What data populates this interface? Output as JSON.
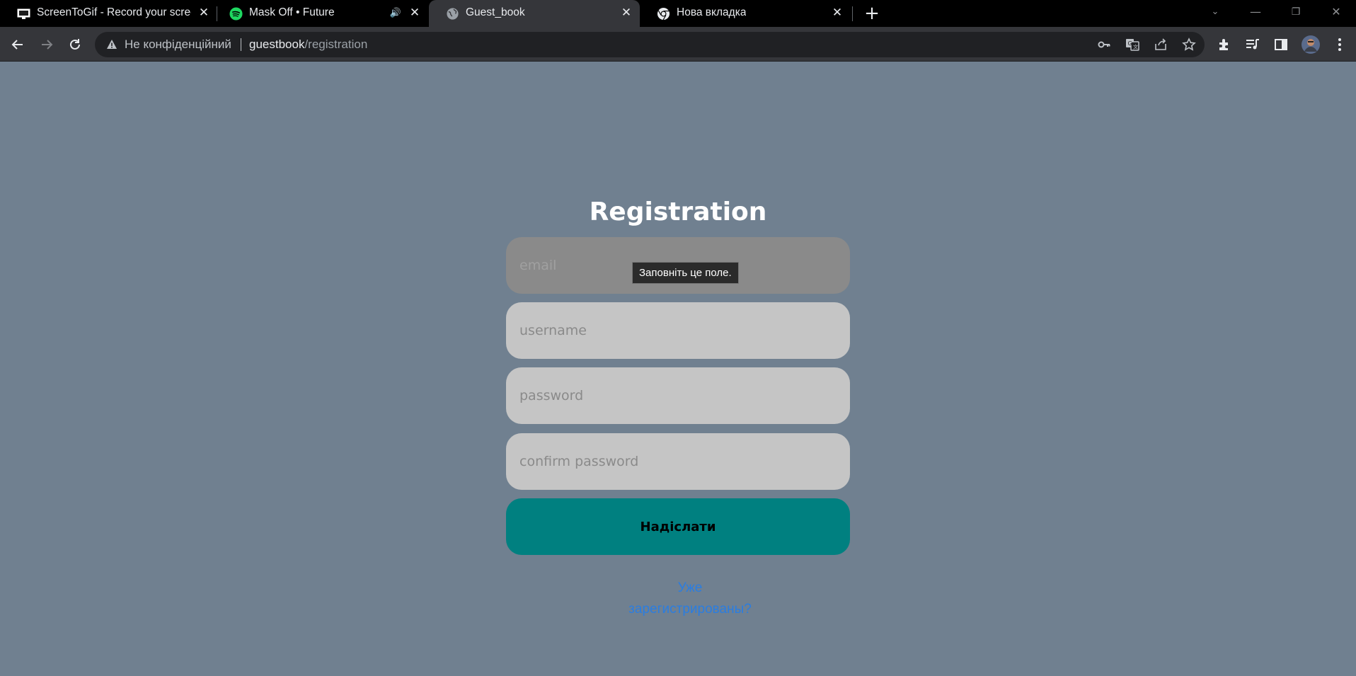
{
  "browser": {
    "tabs": [
      {
        "title": "ScreenToGif - Record your screen",
        "icon": "screentogif-favicon",
        "active": false
      },
      {
        "title": "Mask Off • Future",
        "icon": "spotify-favicon",
        "active": false,
        "audio": true
      },
      {
        "title": "Guest_book",
        "icon": "globe-favicon",
        "active": true
      },
      {
        "title": "Нова вкладка",
        "icon": "chrome-favicon",
        "active": false
      }
    ],
    "address_bar": {
      "security_label": "Не конфіденційний",
      "host": "guestbook",
      "path": "/registration"
    }
  },
  "page": {
    "title": "Registration",
    "fields": {
      "email_placeholder": "email",
      "username_placeholder": "username",
      "password_placeholder": "password",
      "confirm_placeholder": "confirm password"
    },
    "submit_label": "Надіслати",
    "login_link_line1": "Уже",
    "login_link_line2": "зарегистрированы?",
    "tooltip": "Заповніть це поле."
  },
  "colors": {
    "page_bg": "#708090",
    "field_bg": "#c5c5c5",
    "submit_bg": "#008080",
    "link": "#2a7de1"
  }
}
